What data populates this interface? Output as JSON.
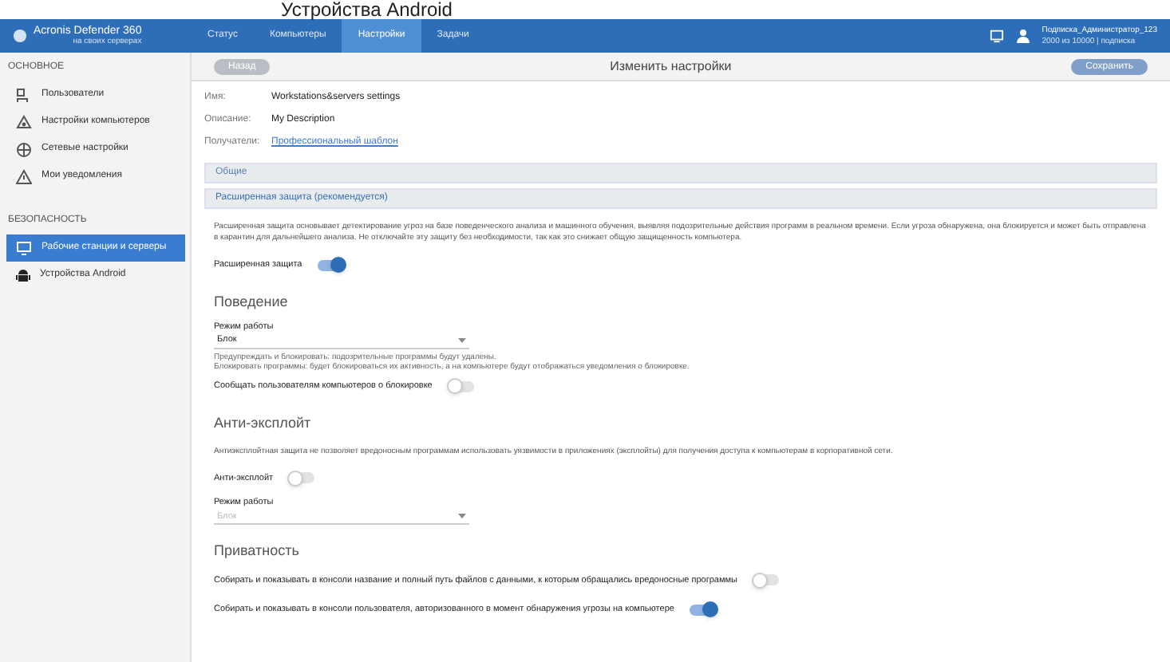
{
  "heading": "Устройства Android",
  "app": {
    "product": "Acronis Defender 360",
    "note": "на своих серверах"
  },
  "nav_tabs": [
    {
      "label": "Статус",
      "selected": false
    },
    {
      "label": "Компьютеры",
      "selected": false
    },
    {
      "label": "Настройки",
      "selected": true
    },
    {
      "label": "Задачи",
      "selected": false
    }
  ],
  "user": {
    "name": "Подписка_Администратор_123",
    "detail": "2000 из 10000 | подписка"
  },
  "sidebar": [
    {
      "title": "ОСНОВНОЕ",
      "items": [
        {
          "label": "Пользователи",
          "selected": false
        },
        {
          "label": "Настройки компьютеров",
          "selected": false
        },
        {
          "label": "Сетевые настройки",
          "selected": false
        },
        {
          "label": "Мои уведомления",
          "selected": false
        }
      ]
    },
    {
      "title": "БЕЗОПАСНОСТЬ",
      "items": [
        {
          "label": "Рабочие станции и серверы",
          "selected": true
        },
        {
          "label": "Устройства Android",
          "selected": false
        }
      ]
    }
  ],
  "toolbar": {
    "back": "Назад",
    "title": "Изменить настройки",
    "save": "Сохранить",
    "save_disabled": true
  },
  "fields": [
    {
      "label": "Имя:",
      "value": "Workstations&servers settings",
      "kind": "text"
    },
    {
      "label": "Описание:",
      "value": "My Description",
      "kind": "text"
    },
    {
      "label": "Получатели:",
      "value": "Профессиональный шаблон",
      "kind": "link"
    }
  ],
  "panels": [
    {
      "title": "Общие",
      "expanded": false
    },
    {
      "title": "Расширенная защита (рекомендуется)",
      "expanded": true
    }
  ],
  "content": [
    {
      "kind": "paragraph",
      "text": "Расширенная защита основывает детектирование угроз на базе поведенческого анализа и машинного обучения, выявляя подозрительные действия программ в реальном времени. Если угроза обнаружена, она блокируется и может быть отправлена в карантин для дальнейшего анализа. Не отключайте эту защиту без необходимости, так как это снижает общую защищенность компьютера."
    },
    {
      "kind": "toggle",
      "label": "Расширенная защита",
      "on": true
    },
    {
      "kind": "heading",
      "text": "Поведение"
    },
    {
      "kind": "select",
      "label": "Режим работы",
      "value": "Блок",
      "disabled": false
    },
    {
      "kind": "note",
      "text": "Предупреждать и блокировать: подозрительные программы будут удалены."
    },
    {
      "kind": "note",
      "text": "Блокировать программы: будет блокироваться их активность, а на компьютере будут отображаться уведомления о блокировке."
    },
    {
      "kind": "toggle",
      "label": "Сообщать пользователям компьютеров о блокировке",
      "on": false
    },
    {
      "kind": "heading",
      "text": "Анти-эксплойт"
    },
    {
      "kind": "paragraph",
      "text": "Антиэксплойтная защита не позволяет вредоносным программам использовать уязвимости в приложениях (эксплойты) для получения доступа к компьютерам в корпоративной сети."
    },
    {
      "kind": "toggle",
      "label": "Анти-эксплойт",
      "on": false
    },
    {
      "kind": "select",
      "label": "Режим работы",
      "value": "Блок",
      "disabled": true
    },
    {
      "kind": "heading",
      "text": "Приватность"
    },
    {
      "kind": "toggle",
      "label": "Собирать и показывать в консоли название и полный путь файлов с данными, к которым обращались вредоносные программы",
      "on": false
    },
    {
      "kind": "toggle",
      "label": "Собирать и показывать в консоли пользователя, авторизованного в момент обнаружения угрозы на компьютере",
      "on": true
    }
  ]
}
